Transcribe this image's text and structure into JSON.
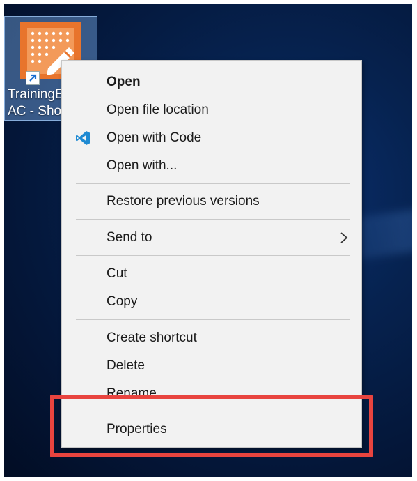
{
  "desktop": {
    "icon_label_line1": "TrainingE",
    "icon_label_line2": "AC - Sho",
    "icon_name": "training-app-icon",
    "icon_color": "#e8742c"
  },
  "context_menu": {
    "items": [
      {
        "label": "Open",
        "bold": true
      },
      {
        "label": "Open file location"
      },
      {
        "label": "Open with Code",
        "icon": "vscode-icon"
      },
      {
        "label": "Open with..."
      },
      {
        "label": "Restore previous versions"
      },
      {
        "label": "Send to",
        "submenu": true
      },
      {
        "label": "Cut"
      },
      {
        "label": "Copy"
      },
      {
        "label": "Create shortcut"
      },
      {
        "label": "Delete"
      },
      {
        "label": "Rename"
      },
      {
        "label": "Properties"
      }
    ]
  },
  "highlight": {
    "target": "Properties",
    "color": "#e8443f"
  }
}
